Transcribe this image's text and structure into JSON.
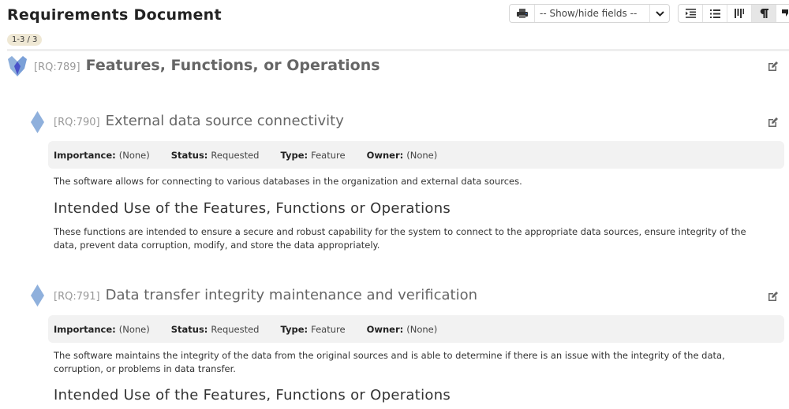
{
  "header": {
    "title": "Requirements Document",
    "count_badge": "1-3 / 3"
  },
  "toolbar": {
    "print_icon": "printer-icon",
    "fields_select_value": "-- Show/hide fields --",
    "caret_icon": "chevron-down-icon",
    "view_buttons": [
      {
        "icon": "indent-icon",
        "glyph": "⇥",
        "active": false
      },
      {
        "icon": "list-icon",
        "glyph": "☰",
        "active": false
      },
      {
        "icon": "columns-icon",
        "glyph": "⫼",
        "active": false
      },
      {
        "icon": "paragraph-icon",
        "glyph": "¶",
        "active": true
      },
      {
        "icon": "comment-icon",
        "glyph": "❞",
        "active": false
      }
    ]
  },
  "colors": {
    "badge_bg": "#efe8d4",
    "diamond": "#8fb0dc",
    "epic_light": "#8fb0dc",
    "epic_dark": "#4a52c9",
    "fields_bg": "#f2f2f2"
  },
  "requirements": [
    {
      "id": "[RQ:789]",
      "title": "Features, Functions, or Operations",
      "icon": "epic-icon"
    },
    {
      "id": "[RQ:790]",
      "title": "External data source connectivity",
      "icon": "requirement-diamond-icon",
      "fields": [
        {
          "label": "Importance:",
          "value": "(None)"
        },
        {
          "label": "Status:",
          "value": "Requested"
        },
        {
          "label": "Type:",
          "value": "Feature"
        },
        {
          "label": "Owner:",
          "value": "(None)"
        }
      ],
      "description": "The software allows for connecting to various databases in the organization and external data sources.",
      "subheading": "Intended Use of the Features, Functions or Operations",
      "subtext": "These functions are intended to ensure a secure and robust capability for the system to connect to the appropriate data sources, ensure integrity of the data, prevent data corruption, modify, and store the data appropriately."
    },
    {
      "id": "[RQ:791]",
      "title": "Data transfer integrity maintenance and verification",
      "icon": "requirement-diamond-icon",
      "fields": [
        {
          "label": "Importance:",
          "value": "(None)"
        },
        {
          "label": "Status:",
          "value": "Requested"
        },
        {
          "label": "Type:",
          "value": "Feature"
        },
        {
          "label": "Owner:",
          "value": "(None)"
        }
      ],
      "description": "The software maintains the integrity of the data from the original sources and is able to determine if there is an issue with the integrity of the data, corruption, or problems in data transfer.",
      "subheading": "Intended Use of the Features, Functions or Operations"
    }
  ]
}
